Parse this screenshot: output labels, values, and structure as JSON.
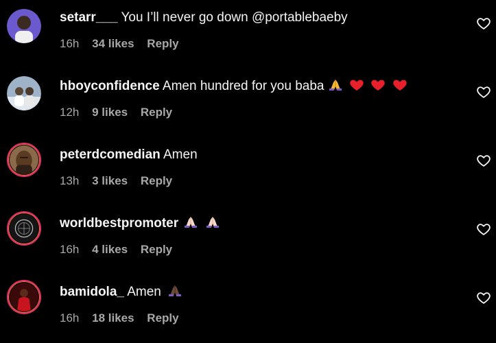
{
  "colors": {
    "background": "#000000",
    "text": "#f5f5f5",
    "meta": "#a8a8a8",
    "story_ring": "#e1306c"
  },
  "comments": [
    {
      "username": "setarr___",
      "text": "You I’ll never go down @portablebaeby",
      "emojis": [],
      "time": "16h",
      "likes": "34 likes",
      "reply": "Reply",
      "like_icon": "heart-outline-icon"
    },
    {
      "username": "hboyconfidence",
      "text": "Amen hundred for you baba",
      "emojis": [
        "folded-hands-emoji",
        "red-heart-emoji",
        "red-heart-emoji",
        "red-heart-emoji"
      ],
      "time": "12h",
      "likes": "9 likes",
      "reply": "Reply",
      "like_icon": "heart-outline-icon"
    },
    {
      "username": "peterdcomedian",
      "text": "Amen",
      "emojis": [],
      "time": "13h",
      "likes": "3 likes",
      "reply": "Reply",
      "like_icon": "heart-outline-icon"
    },
    {
      "username": "worldbestpromoter",
      "text": "",
      "emojis": [
        "folded-hands-light-emoji",
        "folded-hands-light-emoji"
      ],
      "time": "16h",
      "likes": "4 likes",
      "reply": "Reply",
      "like_icon": "heart-outline-icon"
    },
    {
      "username": "bamidola_",
      "text": "Amen",
      "emojis": [
        "folded-hands-dark-emoji"
      ],
      "time": "16h",
      "likes": "18 likes",
      "reply": "Reply",
      "like_icon": "heart-outline-icon"
    }
  ]
}
